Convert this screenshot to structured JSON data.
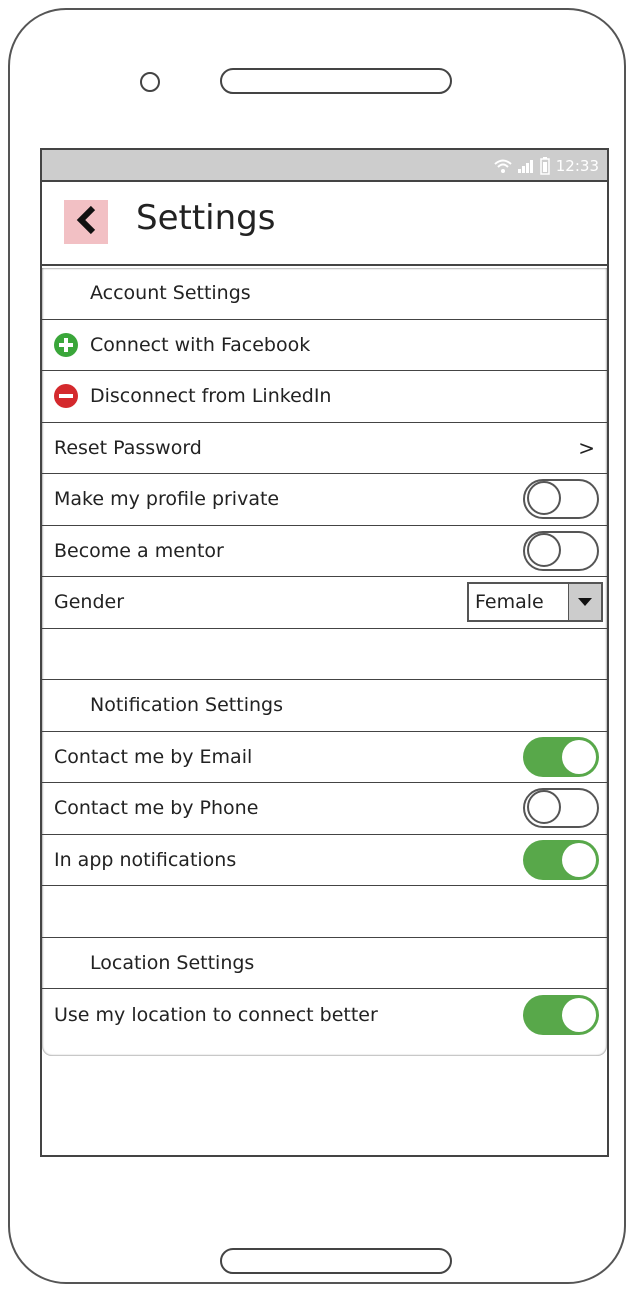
{
  "statusbar": {
    "time": "12:33"
  },
  "appbar": {
    "title": "Settings"
  },
  "account": {
    "header": "Account Settings",
    "facebook": "Connect with Facebook",
    "linkedin": "Disconnect from LinkedIn",
    "reset": "Reset Password",
    "reset_chevron": ">",
    "private": "Make my profile private",
    "mentor": "Become a mentor",
    "gender_label": "Gender",
    "gender_value": "Female"
  },
  "notification": {
    "header": "Notification Settings",
    "email": "Contact me by Email",
    "phone": "Contact me by Phone",
    "inapp": "In app notifications"
  },
  "location": {
    "header": "Location Settings",
    "use": "Use my location to connect better"
  },
  "toggles": {
    "private": false,
    "mentor": false,
    "email": true,
    "phone": false,
    "inapp": true,
    "location": true
  },
  "colors": {
    "toggle_on": "#58a84a",
    "plus_icon": "#3aa63a",
    "minus_icon": "#d4292d",
    "back_button_bg": "#f2c0c4",
    "statusbar_bg": "#cdcdcd"
  }
}
